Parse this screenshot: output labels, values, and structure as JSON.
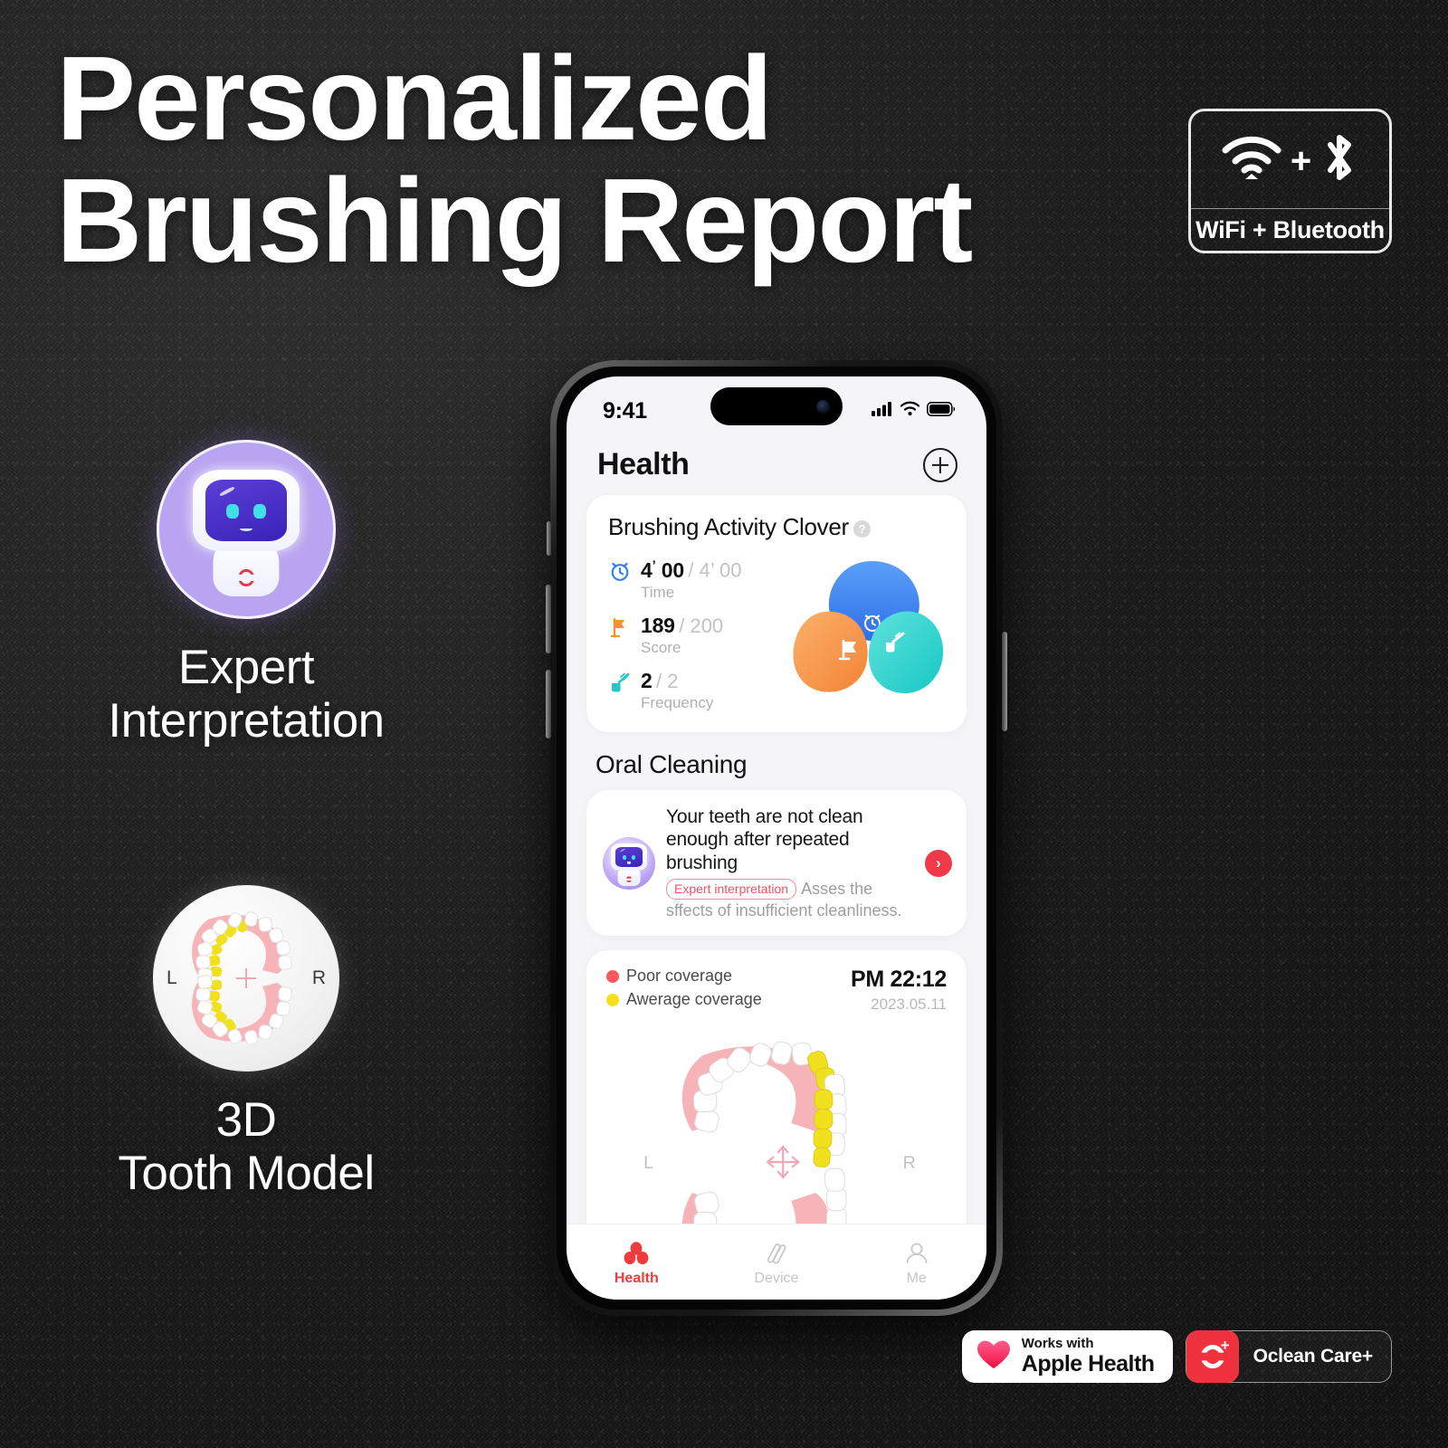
{
  "headline": {
    "line1": "Personalized",
    "line2": "Brushing Report"
  },
  "connectivity_badge": {
    "caption": "WiFi + Bluetooth",
    "plus": "+",
    "wifi_icon": "wifi-icon",
    "bluetooth_icon": "bluetooth-icon"
  },
  "features": [
    {
      "id": "expert",
      "caption_line1": "Expert",
      "caption_line2": "Interpretation",
      "icon": "robot-mascot-icon",
      "circle_color": "#b8a4f0"
    },
    {
      "id": "tooth3d",
      "caption_line1": "3D",
      "caption_line2": "Tooth Model",
      "icon": "jaw-model-icon",
      "left_label": "L",
      "right_label": "R"
    }
  ],
  "phone": {
    "status_bar": {
      "time": "9:41",
      "cellular_icon": "cellular-signal-icon",
      "wifi_icon": "wifi-icon",
      "battery_icon": "battery-icon"
    },
    "nav": {
      "title": "Health",
      "add_icon": "plus-circle-icon"
    },
    "clover_card": {
      "title": "Brushing Activity Clover",
      "help_icon": "question-mark-icon",
      "metrics": [
        {
          "icon": "alarm-clock-icon",
          "value": "4",
          "value_sup": "’",
          "value_rest": "00",
          "target": "/ 4’ 00",
          "label": "Time",
          "color": "#2f7ff0"
        },
        {
          "icon": "flag-icon",
          "value": "189",
          "value_sup": "",
          "value_rest": "",
          "target": "/ 200",
          "label": "Score",
          "color": "#f5912f"
        },
        {
          "icon": "toothbrush-icon",
          "value": "2",
          "value_sup": "",
          "value_rest": "",
          "target": "/ 2",
          "label": "Frequency",
          "color": "#22c8c8"
        }
      ],
      "petals": [
        {
          "name": "time-petal",
          "icon": "alarm-clock-icon",
          "color_top": "#5aa0f7",
          "color_bottom": "#2f6fe8"
        },
        {
          "name": "score-petal",
          "icon": "flag-icon",
          "color_top": "#fbb06a",
          "color_bottom": "#f38435"
        },
        {
          "name": "frequency-petal",
          "icon": "toothbrush-icon",
          "color_top": "#5fe3dc",
          "color_bottom": "#18c7c4"
        }
      ]
    },
    "oral_cleaning": {
      "section_title": "Oral Cleaning",
      "expert_card": {
        "avatar_icon": "robot-mascot-icon",
        "headline": "Your teeth are not clean enough after repeated brushing",
        "chip": "Expert interpretation",
        "subtext": "Asses the sffects of insufficient cleanliness.",
        "arrow_icon": "chevron-right-icon"
      },
      "tooth_card": {
        "legend": [
          {
            "label": "Poor coverage",
            "color": "#fa5a5a"
          },
          {
            "label": "Awerage coverage",
            "color": "#f7e016"
          }
        ],
        "time": "PM 22:12",
        "date": "2023.05.11",
        "left_label": "L",
        "right_label": "R",
        "move_icon": "move-crosshair-icon"
      }
    },
    "tabbar": [
      {
        "label": "Health",
        "icon": "clover-health-icon",
        "active": true
      },
      {
        "label": "Device",
        "icon": "brush-strokes-icon",
        "active": false
      },
      {
        "label": "Me",
        "icon": "person-icon",
        "active": false
      }
    ]
  },
  "badges": {
    "apple": {
      "line1": "Works with",
      "line2": "Apple Health",
      "icon": "heart-icon"
    },
    "oclean": {
      "label": "Oclean Care+",
      "mark_icon": "oclean-logo-icon",
      "plus": "+"
    }
  }
}
